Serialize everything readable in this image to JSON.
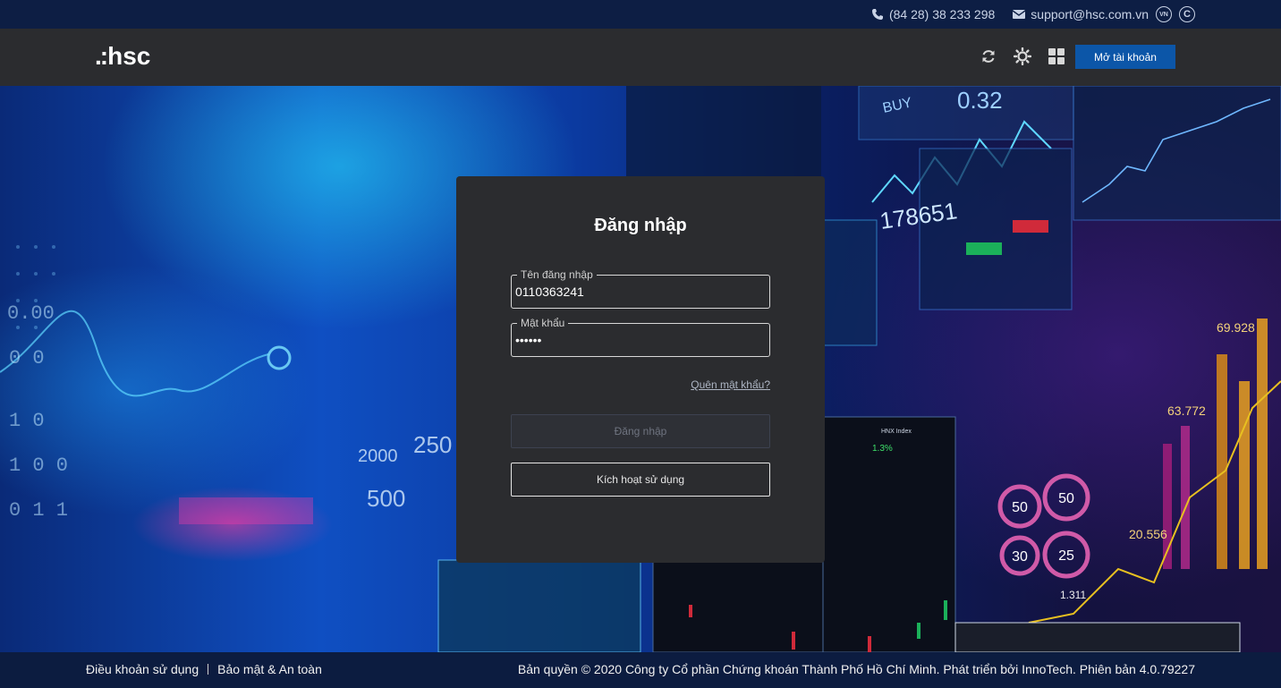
{
  "topbar": {
    "phone": "(84 28) 38 233 298",
    "email": "support@hsc.com.vn",
    "lang_badge": "VN",
    "phone_icon": "phone-icon",
    "email_icon": "envelope-icon",
    "copyright_icon": "copyright-icon"
  },
  "header": {
    "logo_dots": ".:",
    "logo_text": "hsc",
    "open_account_label": "Mở tài khoản",
    "icons": [
      "refresh-icon",
      "brightness-icon",
      "grid-icon"
    ],
    "accent_color": "#0c56a8"
  },
  "login": {
    "title": "Đăng nhập",
    "username_label": "Tên đăng nhập",
    "username_value": "0110363241",
    "password_label": "Mật khẩu",
    "password_value": "••••••",
    "forgot_label": "Quên mật khẩu?",
    "login_button": "Đăng nhập",
    "activate_button": "Kích hoạt sử dụng"
  },
  "hero": {
    "labels": [
      "BUY",
      "0.32",
      "69.928",
      "63.772",
      "20.556",
      "1.311",
      "50",
      "50",
      "30",
      "25",
      "250",
      "2000",
      "500",
      "HNX Index",
      "1.3%"
    ]
  },
  "footer": {
    "terms": "Điều khoản sử dụng",
    "security": "Bảo mật & An toàn",
    "copyright": "Bản quyền © 2020 Công ty Cổ phần Chứng khoán Thành Phố Hồ Chí Minh. Phát triển bởi InnoTech. Phiên bản 4.0.79227"
  }
}
